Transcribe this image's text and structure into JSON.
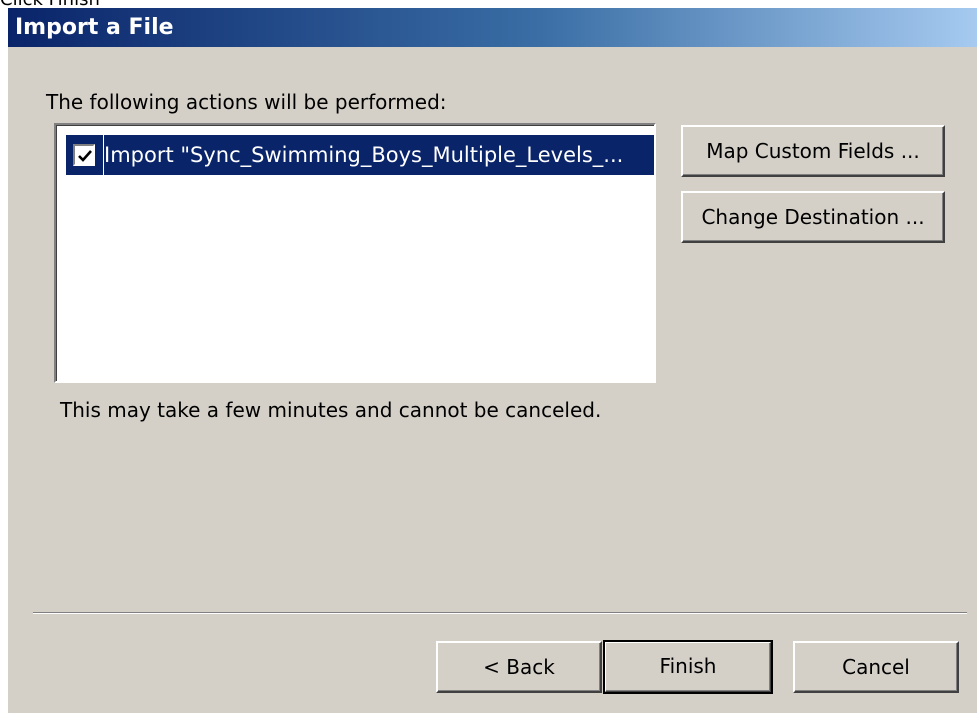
{
  "page_caption": "Click Finish",
  "dialog": {
    "title": "Import a File"
  },
  "actions": {
    "label": "The following actions will be performed:",
    "items": [
      {
        "checked": true,
        "text": "Import \"Sync_Swimming_Boys_Multiple_Levels_..."
      }
    ]
  },
  "side_buttons": {
    "map_custom_fields": "Map Custom Fields ...",
    "change_destination": "Change Destination ..."
  },
  "note": "This may take a few minutes and cannot be canceled.",
  "footer": {
    "back": "< Back",
    "finish": "Finish",
    "cancel": "Cancel"
  },
  "colors": {
    "dialog_face": "#d4d0c8",
    "title_gradient_start": "#0a246a",
    "title_gradient_end": "#a6caf0",
    "selection": "#0a246a"
  }
}
